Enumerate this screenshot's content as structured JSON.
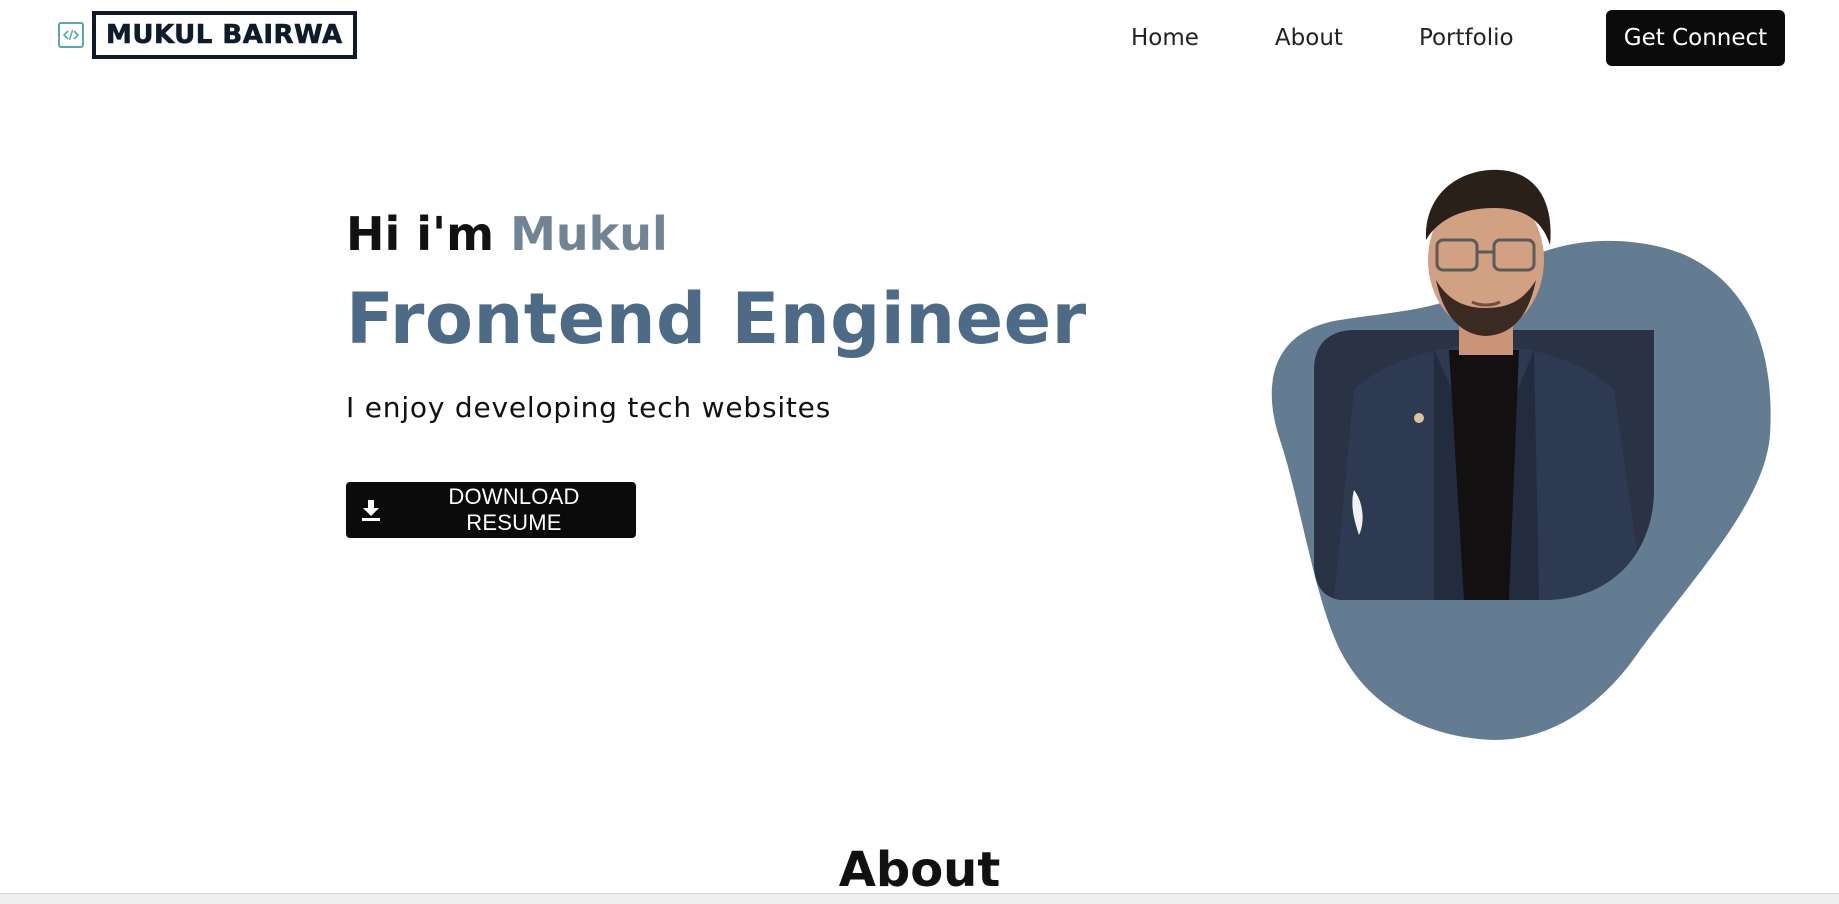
{
  "header": {
    "logo_text": "MUKUL BAIRWA",
    "nav": [
      "Home",
      "About",
      "Portfolio"
    ],
    "cta_label": "Get Connect"
  },
  "hero": {
    "greeting_prefix": "Hi i'm",
    "greeting_name": "Mukul",
    "role": "Frontend Engineer",
    "tagline": "I enjoy developing tech websites",
    "download_label": "DOWNLOAD RESUME"
  },
  "about": {
    "heading": "About"
  },
  "icons": {
    "logo": "code-icon",
    "download": "download-icon"
  },
  "colors": {
    "accent": "#4d6a86",
    "name_accent": "#6f8596",
    "blob": "#647c92",
    "button_bg": "#0b0b0b",
    "logo_icon": "#5aa7a8"
  }
}
